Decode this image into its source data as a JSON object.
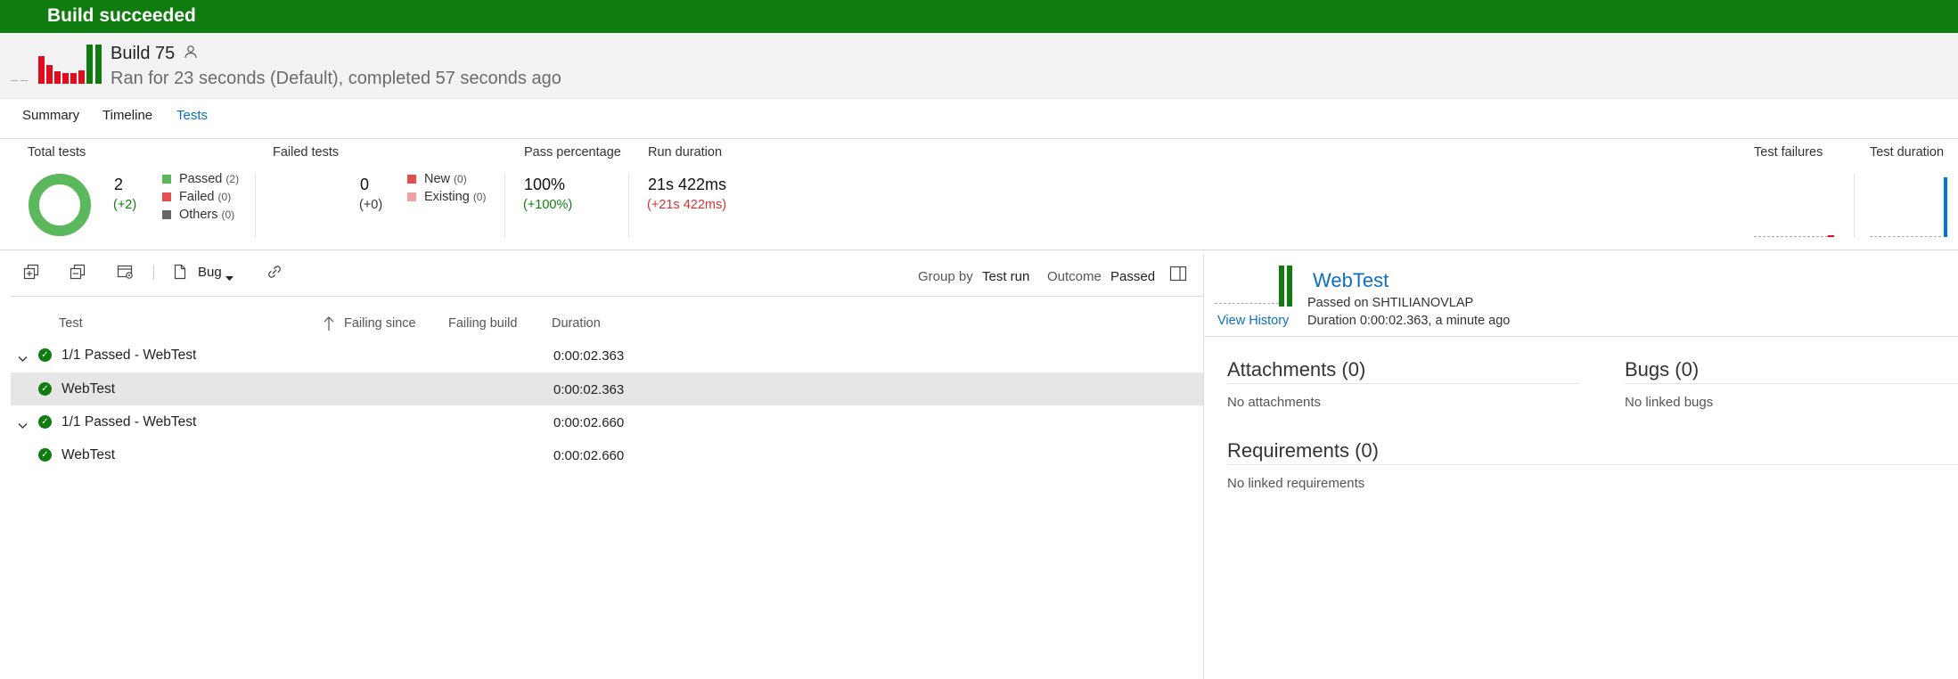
{
  "banner": {
    "title": "Build succeeded"
  },
  "header": {
    "build_title": "Build 75",
    "subtitle": "Ran for 23 seconds (Default), completed 57 seconds ago"
  },
  "tabs": [
    {
      "label": "Summary"
    },
    {
      "label": "Timeline"
    },
    {
      "label": "Tests"
    }
  ],
  "summary": {
    "total": {
      "label": "Total tests",
      "count": "2",
      "delta": "(+2)",
      "legend": [
        {
          "label": "Passed",
          "count": "(2)",
          "color": "#5cb85c"
        },
        {
          "label": "Failed",
          "count": "(0)",
          "color": "#e05050"
        },
        {
          "label": "Others",
          "count": "(0)",
          "color": "#666666"
        }
      ]
    },
    "failed": {
      "label": "Failed tests",
      "count": "0",
      "delta": "(+0)",
      "legend": [
        {
          "label": "New",
          "count": "(0)",
          "color": "#e05050"
        },
        {
          "label": "Existing",
          "count": "(0)",
          "color": "#f0a0a0"
        }
      ]
    },
    "pass": {
      "label": "Pass percentage",
      "value": "100%",
      "delta": "(+100%)"
    },
    "duration": {
      "label": "Run duration",
      "value": "21s 422ms",
      "delta": "(+21s 422ms)"
    },
    "trends": {
      "failures_label": "Test failures",
      "duration_label": "Test duration"
    }
  },
  "toolbar": {
    "bug_label": "Bug",
    "group_by_label": "Group by",
    "group_by_value": "Test run",
    "outcome_label": "Outcome",
    "outcome_value": "Passed"
  },
  "table": {
    "columns": {
      "test": "Test",
      "failing_since": "Failing since",
      "failing_build": "Failing build",
      "duration": "Duration"
    },
    "rows": [
      {
        "name": "1/1 Passed - WebTest",
        "duration": "0:00:02.363",
        "is_group": true
      },
      {
        "name": "WebTest",
        "duration": "0:00:02.363",
        "is_group": false,
        "selected": true
      },
      {
        "name": "1/1 Passed - WebTest",
        "duration": "0:00:02.660",
        "is_group": true
      },
      {
        "name": "WebTest",
        "duration": "0:00:02.660",
        "is_group": false
      }
    ]
  },
  "detail": {
    "title": "WebTest",
    "passed_on": "Passed on SHTILIANOVLAP",
    "view_history": "View History",
    "duration": "Duration 0:00:02.363, a minute ago",
    "attachments": {
      "title": "Attachments (0)",
      "empty": "No attachments"
    },
    "bugs": {
      "title": "Bugs (0)",
      "empty": "No linked bugs"
    },
    "requirements": {
      "title": "Requirements (0)",
      "empty": "No linked requirements"
    }
  },
  "colors": {
    "success": "#107c10",
    "link": "#106ebe",
    "delta_positive": "#107c10",
    "delta_negative": "#d13438",
    "history_failed": "#e00b1c"
  }
}
